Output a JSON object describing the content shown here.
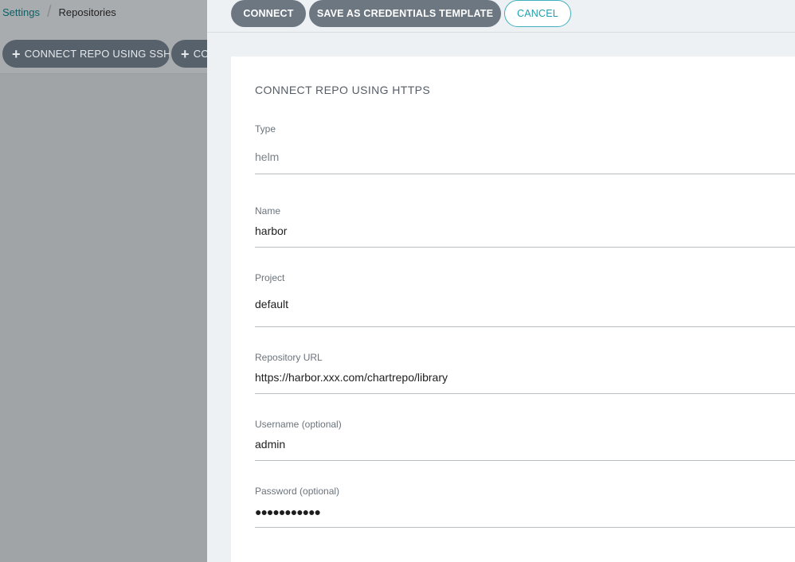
{
  "breadcrumb": {
    "parent": "Settings",
    "current": "Repositories"
  },
  "background_actions": [
    {
      "label": "CONNECT REPO USING SSH"
    },
    {
      "label": "CONNECT REPO USING HTTPS"
    }
  ],
  "toolbar": {
    "connect": "CONNECT",
    "save_template": "SAVE AS CREDENTIALS TEMPLATE",
    "cancel": "CANCEL"
  },
  "form": {
    "title": "CONNECT REPO USING HTTPS",
    "type": {
      "label": "Type",
      "value": "helm"
    },
    "name": {
      "label": "Name",
      "value": "harbor"
    },
    "project": {
      "label": "Project",
      "value": "default"
    },
    "repo_url": {
      "label": "Repository URL",
      "value": "https://harbor.xxx.com/chartrepo/library"
    },
    "username": {
      "label": "Username (optional)",
      "value": "admin"
    },
    "password": {
      "label": "Password (optional)",
      "value": "●●●●●●●●●●●"
    }
  },
  "colors": {
    "accent": "#1f9fac",
    "dark_button": "#6c7782",
    "overlay": "#a1a4a7"
  }
}
